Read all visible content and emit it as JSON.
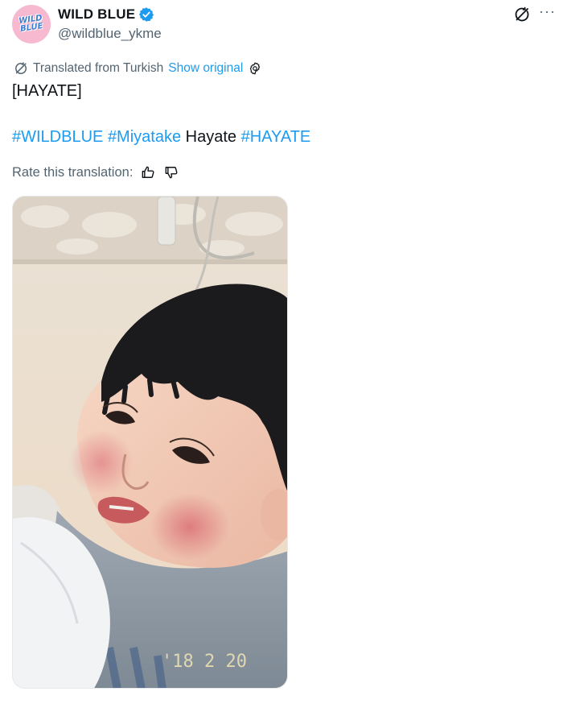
{
  "author": {
    "display_name": "WILD BLUE",
    "handle": "@wildblue_ykme",
    "avatar_text": "WILD\nBLUE",
    "verified": true
  },
  "translation": {
    "label": "Translated from Turkish",
    "show_original": "Show original",
    "rate_label": "Rate this translation:"
  },
  "tweet": {
    "title": "[HAYATE]",
    "segments": [
      {
        "text": "#WILDBLUE",
        "kind": "hashtag"
      },
      {
        "text": " ",
        "kind": "plain"
      },
      {
        "text": "#Miyatake",
        "kind": "hashtag"
      },
      {
        "text": " Hayate ",
        "kind": "plain"
      },
      {
        "text": "#HAYATE",
        "kind": "hashtag"
      }
    ]
  },
  "media": {
    "date_stamp": "'18  2 20"
  },
  "colors": {
    "link": "#1d9bf0",
    "muted": "#536471",
    "verified": "#1d9bf0",
    "avatar_bg": "#f7b9cf"
  },
  "icons": {
    "translate": "translate-icon",
    "more": "more-icon",
    "settings": "settings-icon",
    "thumbs_up": "thumbs-up-icon",
    "thumbs_down": "thumbs-down-icon",
    "verified": "verified-badge-icon"
  }
}
